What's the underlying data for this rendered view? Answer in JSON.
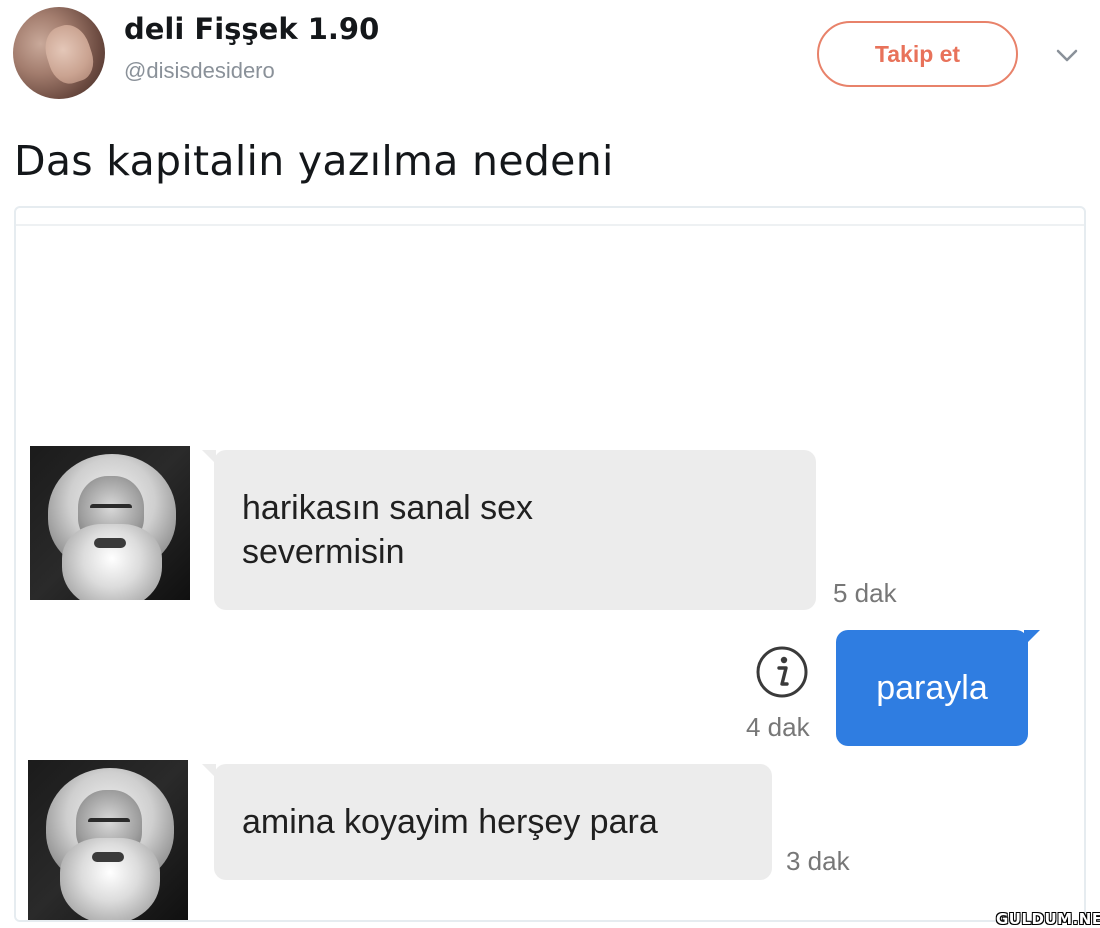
{
  "tweet": {
    "author": {
      "display_name": "deli Fişşek 1.90",
      "handle": "@disisdesidero",
      "avatar_icon": "user-avatar-photo"
    },
    "follow_button_label": "Takip et",
    "menu_icon": "chevron-down-icon",
    "text": "Das kapitalin yazılma nedeni",
    "accent_color": "#e8725a"
  },
  "chat": {
    "contact_avatar_icon": "karl-marx-portrait",
    "messages": [
      {
        "direction": "incoming",
        "lines": [
          "harikasın sanal sex",
          "severmisin"
        ],
        "time": "5 dak"
      },
      {
        "direction": "outgoing",
        "text": "parayla",
        "time": "4 dak",
        "status_icon": "info-icon"
      },
      {
        "direction": "incoming",
        "lines": [
          "amina koyayim herşey para"
        ],
        "time": "3 dak"
      }
    ],
    "incoming_bubble_color": "#ececec",
    "outgoing_bubble_color": "#2f7de1"
  },
  "watermark": "GULDUM.NET"
}
